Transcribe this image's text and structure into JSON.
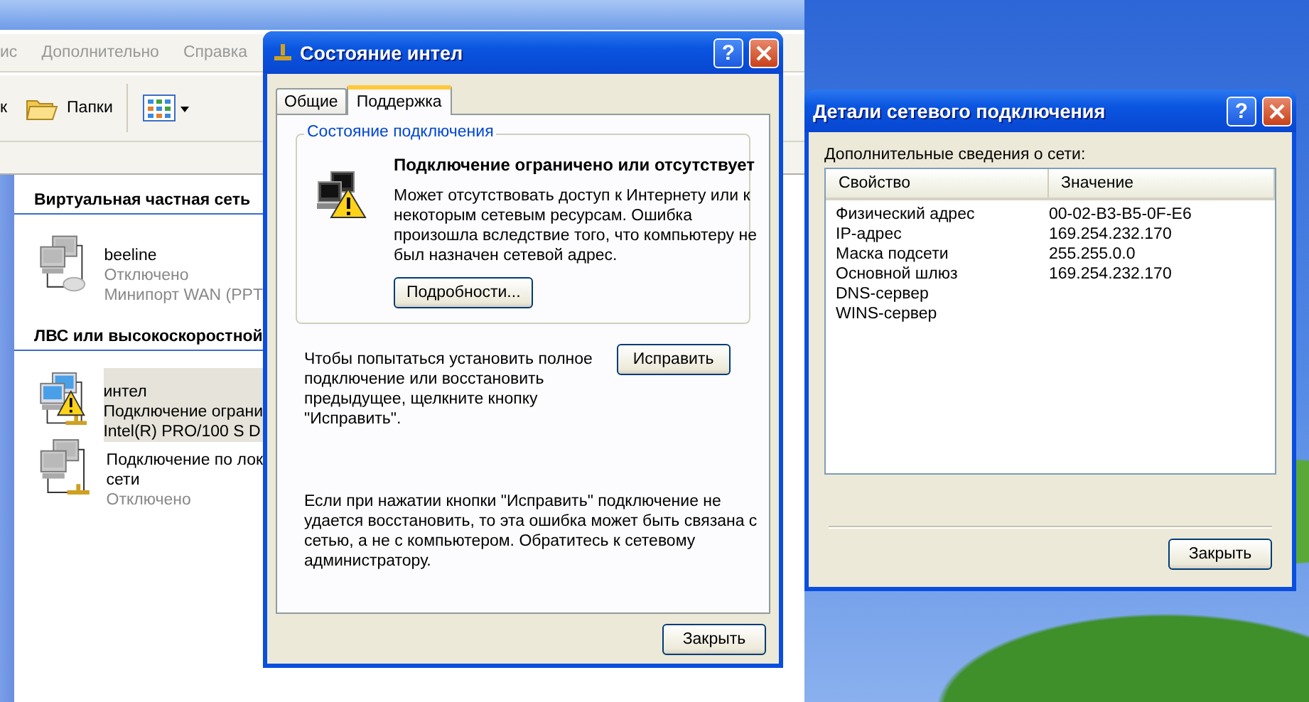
{
  "explorer": {
    "menu": [
      "ис",
      "Дополнительно",
      "Справка"
    ],
    "toolbar": {
      "search_fragment": "к",
      "folders": "Папки"
    },
    "sections": [
      {
        "title": "Виртуальная частная сеть",
        "items": [
          {
            "kind": "vpn",
            "disabled": true,
            "warning": false,
            "selected": false,
            "name_lines": [
              "beeline"
            ],
            "details": [
              "Отключено",
              "Минипорт WAN (PPT"
            ]
          }
        ]
      },
      {
        "title": "ЛВС или высокоскоростной",
        "items": [
          {
            "kind": "lan",
            "disabled": false,
            "warning": true,
            "selected": true,
            "name_lines": [
              "интел"
            ],
            "details": [
              "Подключение ограни",
              "Intel(R) PRO/100 S D"
            ]
          },
          {
            "kind": "lan",
            "disabled": true,
            "warning": false,
            "selected": false,
            "name_lines": [
              "Подключение по лок",
              "сети"
            ],
            "details": [
              "Отключено"
            ]
          }
        ]
      }
    ]
  },
  "status_dialog": {
    "title": "Состояние интел",
    "help_button": "?",
    "tabs": [
      {
        "label": "Общие",
        "selected": false
      },
      {
        "label": "Поддержка",
        "selected": true
      }
    ],
    "group": {
      "title": "Состояние подключения",
      "heading": "Подключение ограничено или отсутствует",
      "text": "Может отсутствовать доступ к Интернету или к некоторым сетевым ресурсам. Ошибка произошла вследствие того, что компьютеру не был назначен сетевой адрес.",
      "button": "Подробности..."
    },
    "repair_text": "Чтобы попытаться установить полное подключение или восстановить предыдущее, щелкните кнопку \"Исправить\".",
    "repair_button": "Исправить",
    "note": "Если при нажатии кнопки \"Исправить\" подключение не удается восстановить, то эта ошибка может быть связана с сетью, а не с компьютером.  Обратитесь к сетевому администратору.",
    "close_button": "Закрыть"
  },
  "details_dialog": {
    "title": "Детали сетевого подключения",
    "help_button": "?",
    "label": "Дополнительные сведения о сети:",
    "columns": [
      "Свойство",
      "Значение"
    ],
    "rows": [
      {
        "property": "Физический адрес",
        "value": "00-02-B3-B5-0F-E6"
      },
      {
        "property": "IP-адрес",
        "value": "169.254.232.170"
      },
      {
        "property": "Маска подсети",
        "value": "255.255.0.0"
      },
      {
        "property": "Основной шлюз",
        "value": "169.254.232.170"
      },
      {
        "property": "DNS-сервер",
        "value": ""
      },
      {
        "property": "WINS-сервер",
        "value": ""
      }
    ],
    "close_button": "Закрыть"
  }
}
